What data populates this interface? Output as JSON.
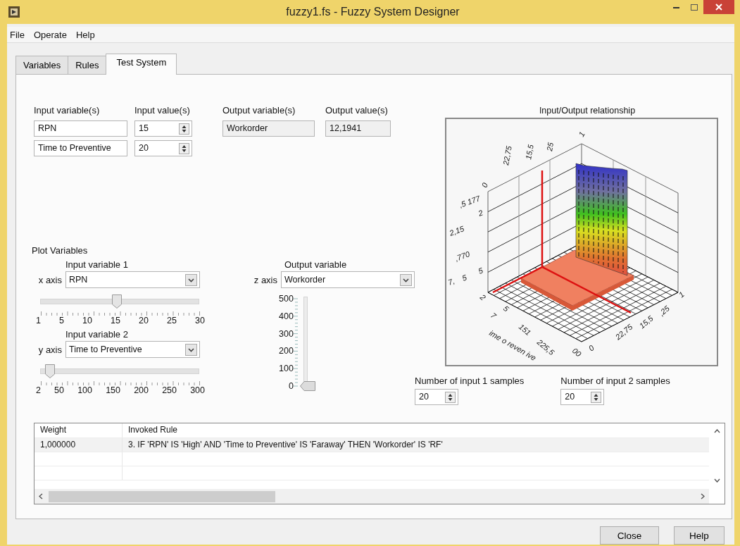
{
  "window": {
    "title": "fuzzy1.fs - Fuzzy System Designer"
  },
  "menu": [
    "File",
    "Operate",
    "Help"
  ],
  "tabs": [
    {
      "label": "Variables",
      "selected": false
    },
    {
      "label": "Rules",
      "selected": false
    },
    {
      "label": "Test System",
      "selected": true
    }
  ],
  "inputs": {
    "variables_label": "Input variable(s)",
    "values_label": "Input value(s)",
    "rows": [
      {
        "variable": "RPN",
        "value": "15"
      },
      {
        "variable": "Time to Preventive",
        "value": "20"
      }
    ]
  },
  "outputs": {
    "variables_label": "Output variable(s)",
    "values_label": "Output value(s)",
    "rows": [
      {
        "variable": "Workorder",
        "value": "12,1941"
      }
    ]
  },
  "plot_variables": {
    "title": "Plot Variables",
    "x": {
      "caption": "Input variable 1",
      "axis": "x axis",
      "value": "RPN",
      "level": 0.48,
      "ticks": [
        "1",
        "5",
        "10",
        "15",
        "20",
        "25",
        "30"
      ]
    },
    "y": {
      "caption": "Input variable 2",
      "axis": "y axis",
      "value": "Time to Preventive",
      "level": 0.06,
      "ticks": [
        "2",
        "50",
        "100",
        "150",
        "200",
        "250",
        "300"
      ]
    },
    "z": {
      "caption": "Output variable",
      "axis": "z axis",
      "value": "Workorder",
      "level": 0,
      "ticks": [
        "500",
        "400",
        "300",
        "200",
        "100",
        "0"
      ]
    }
  },
  "plot": {
    "title": "Input/Output relationship",
    "tick_labels": [
      "0",
      "22,75",
      "15,5",
      "25",
      "1",
      ",5 177",
      "2",
      "2,15",
      ",770",
      "5",
      "5",
      "7,",
      "2",
      "7",
      "5",
      "151",
      "225,5",
      "00",
      "ime o reven ive",
      "1",
      ",25",
      "15,5",
      "22,75",
      "0"
    ]
  },
  "samples": [
    {
      "label": "Number of input 1 samples",
      "value": "20"
    },
    {
      "label": "Number of input 2 samples",
      "value": "20"
    }
  ],
  "table": {
    "columns": [
      "Weight",
      "Invoked Rule"
    ],
    "rows": [
      [
        "1,000000",
        "3. IF 'RPN' IS 'High' AND 'Time to Preventive' IS 'Faraway' THEN 'Workorder' IS 'RF'"
      ]
    ]
  },
  "buttons": [
    "Close",
    "Help"
  ]
}
